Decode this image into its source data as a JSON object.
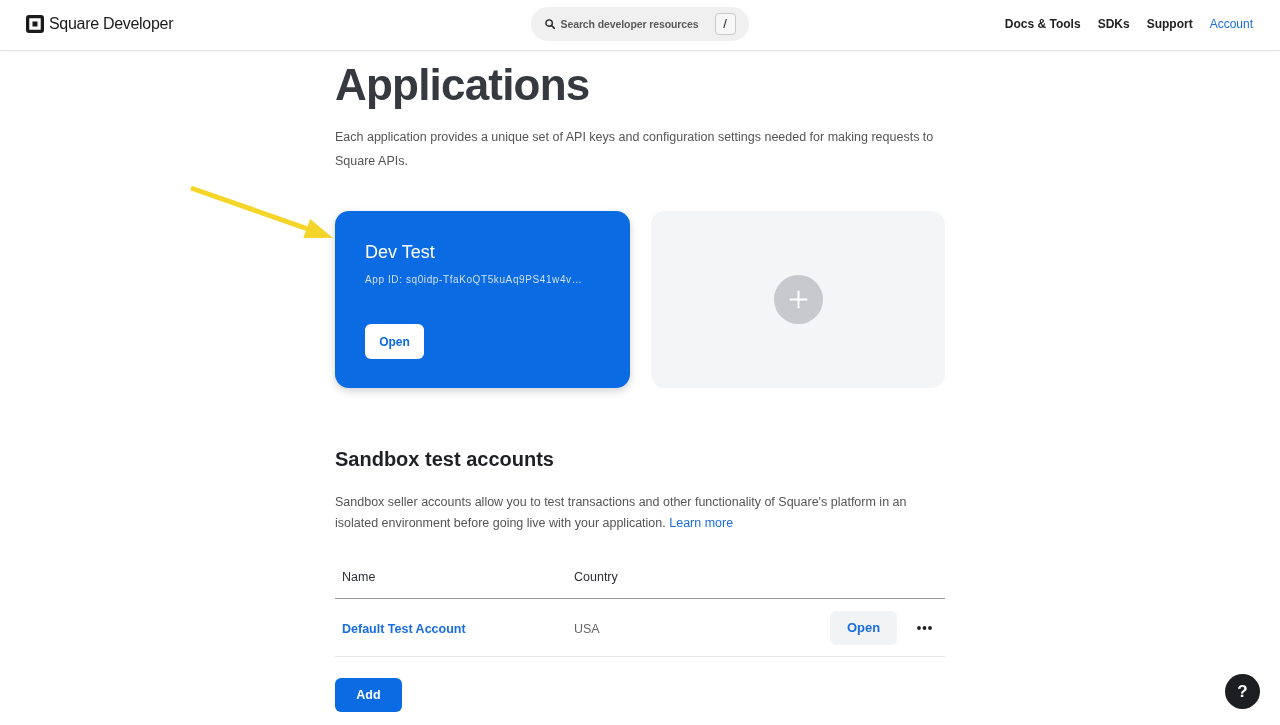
{
  "header": {
    "logo_text": "Square Developer",
    "search": {
      "placeholder": "Search developer resources",
      "shortcut": "/"
    },
    "nav": [
      {
        "label": "Docs & Tools",
        "selected": false
      },
      {
        "label": "SDKs",
        "selected": false
      },
      {
        "label": "Support",
        "selected": false
      },
      {
        "label": "Account",
        "selected": true
      }
    ]
  },
  "page": {
    "title": "Applications",
    "description": "Each application provides a unique set of API keys and configuration settings needed for making requests to Square APIs."
  },
  "applications": [
    {
      "name": "Dev Test",
      "app_id": "App ID: sq0idp-TfaKoQT5kuAq9PS41w4v…",
      "button": "Open"
    }
  ],
  "sandbox": {
    "title": "Sandbox test accounts",
    "description": "Sandbox seller accounts allow you to test transactions and other functionality of Square's platform in an isolated environment before going live with your application.",
    "link": "Learn more",
    "table": {
      "columns": [
        "Name",
        "Country"
      ],
      "rows": [
        {
          "name": "Default Test Account",
          "country": "USA",
          "button": "Open"
        }
      ]
    },
    "add_button": "Add"
  },
  "help_button": {
    "label": "?"
  }
}
